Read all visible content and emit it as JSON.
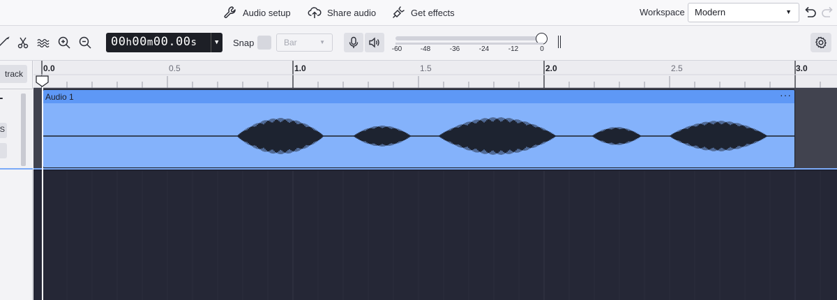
{
  "topbar": {
    "audio_setup": "Audio setup",
    "share_audio": "Share audio",
    "get_effects": "Get effects",
    "workspace_label": "Workspace",
    "workspace_value": "Modern"
  },
  "toolbar": {
    "timecode": {
      "h": "00",
      "m": "00",
      "s": "00.00"
    },
    "snap_label": "Snap",
    "snap_value": "Bar",
    "meter_ticks": [
      "-60",
      "-48",
      "-36",
      "-24",
      "-12",
      "0"
    ]
  },
  "leftpanel": {
    "add_track": "track",
    "btn_s": "S"
  },
  "ruler": {
    "labels": [
      "0.0",
      "0.5",
      "1.0",
      "1.5",
      "2.0",
      "2.5",
      "3.0"
    ]
  },
  "clip": {
    "name": "Audio 1",
    "menu": "···"
  },
  "colors": {
    "clip_body": "#84b2fb",
    "clip_header": "#5e98f6",
    "timeline_bg": "#252736",
    "selection": "#7aaaf7"
  }
}
